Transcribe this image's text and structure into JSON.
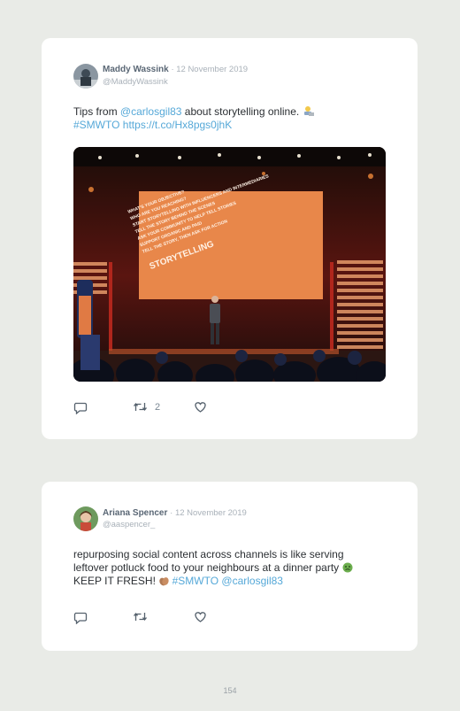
{
  "tweets": [
    {
      "author": "Maddy Wassink",
      "date": "· 12 November 2019",
      "handle": "@MaddyWassink",
      "text_before": "Tips from ",
      "mention": "@carlosgil83",
      "text_after": " about storytelling online. ",
      "emoji": "woman-technologist-emoji",
      "hashtag": "#SMWTO",
      "url": "https://t.co/Hx8pgs0jhK",
      "photo": {
        "screen_lines": [
          "WHAT'S YOUR OBJECTIVE?",
          "WHO ARE YOU REACHING?",
          "START STORYTELLING WITH INFLUENCERS AND INTERMEDIARIES",
          "TELL THE STORY BEHIND THE SCENES",
          "ASK YOUR COMMUNITY TO HELP TELL STORIES",
          "SUPPORT ORGANIC AND PAID",
          "TELL THE STORY, THEN ASK FOR ACTION"
        ],
        "screen_title": "STORYTELLING"
      },
      "actions": {
        "reply_icon": "reply-icon",
        "retweet_icon": "retweet-icon",
        "retweet_count": "2",
        "like_icon": "heart-icon"
      }
    },
    {
      "author": "Ariana Spencer",
      "date": "· 12 November 2019",
      "handle": "@aaspencer_",
      "line1": "repurposing social content across channels is like serving",
      "line2": "leftover potluck food to your neighbours at a dinner party ",
      "line3_text": "KEEP IT FRESH! ",
      "emoji1": "nauseated-face-emoji",
      "emoji2": "clapping-hands-emoji",
      "hashtag": "#SMWTO",
      "mention": "@carlosgil83",
      "actions": {
        "reply_icon": "reply-icon",
        "retweet_icon": "retweet-icon",
        "like_icon": "heart-icon"
      }
    }
  ],
  "page_number": "154"
}
